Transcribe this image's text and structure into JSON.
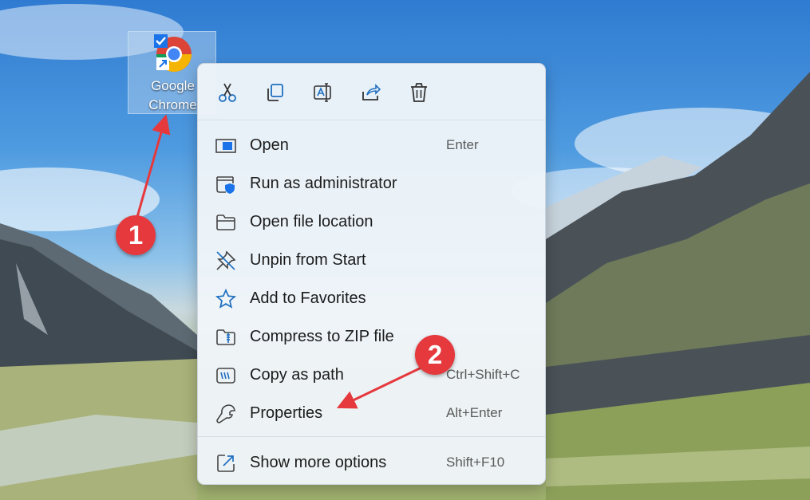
{
  "desktop_icon": {
    "label_line1": "Google",
    "label_line2": "Chrome"
  },
  "toolbar": [
    {
      "icon": "cut-icon"
    },
    {
      "icon": "copy-icon"
    },
    {
      "icon": "rename-icon"
    },
    {
      "icon": "share-icon"
    },
    {
      "icon": "delete-icon"
    }
  ],
  "menu_items": [
    {
      "label": "Open",
      "shortcut": "Enter",
      "icon": "open-icon"
    },
    {
      "label": "Run as administrator",
      "shortcut": "",
      "icon": "shield-icon"
    },
    {
      "label": "Open file location",
      "shortcut": "",
      "icon": "folder-icon"
    },
    {
      "label": "Unpin from Start",
      "shortcut": "",
      "icon": "unpin-icon"
    },
    {
      "label": "Add to Favorites",
      "shortcut": "",
      "icon": "star-icon"
    },
    {
      "label": "Compress to ZIP file",
      "shortcut": "",
      "icon": "zip-icon"
    },
    {
      "label": "Copy as path",
      "shortcut": "Ctrl+Shift+C",
      "icon": "copy-path-icon"
    },
    {
      "label": "Properties",
      "shortcut": "Alt+Enter",
      "icon": "wrench-icon"
    }
  ],
  "more_options": {
    "label": "Show more options",
    "shortcut": "Shift+F10",
    "icon": "show-more-icon"
  },
  "annotations": [
    {
      "number": "1"
    },
    {
      "number": "2"
    }
  ],
  "colors": {
    "accent_blue": "#0f6cbd",
    "badge_red": "#e5393d"
  }
}
